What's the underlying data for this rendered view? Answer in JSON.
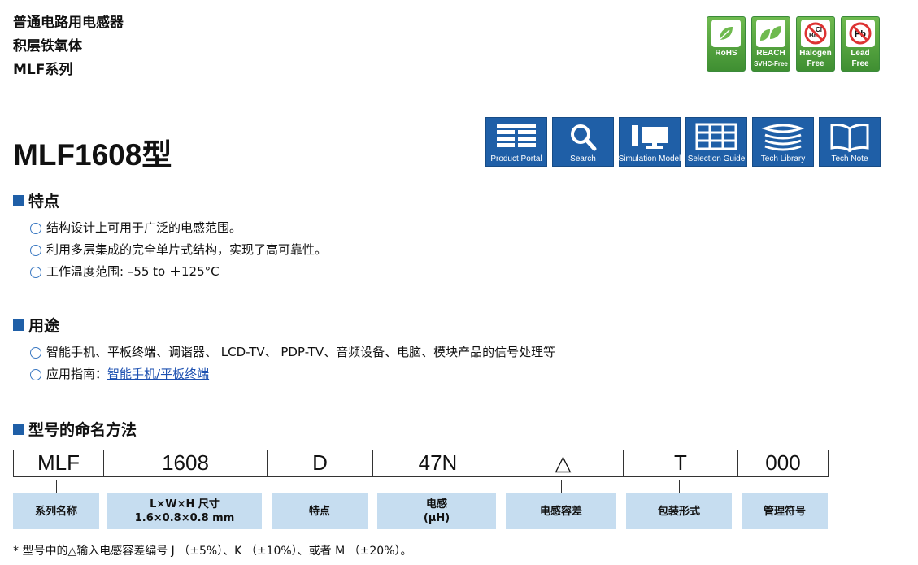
{
  "header": {
    "series_lines": [
      "普通电路用电感器",
      "积层铁氧体",
      "MLF系列"
    ],
    "badges": [
      {
        "icon": "leaf-icon",
        "lines": [
          "RoHS"
        ]
      },
      {
        "icon": "leaf-pair-icon",
        "lines": [
          "REACH",
          "SVHC-Free"
        ]
      },
      {
        "icon": "no-halogen-icon",
        "mark": "ClBr",
        "lines": [
          "Halogen",
          "Free"
        ]
      },
      {
        "icon": "no-lead-icon",
        "mark": "Pb",
        "lines": [
          "Lead",
          "Free"
        ]
      }
    ]
  },
  "model_title": "MLF1608型",
  "tools": [
    {
      "icon": "product-portal-icon",
      "label": "Product Portal"
    },
    {
      "icon": "search-icon",
      "label": "Search"
    },
    {
      "icon": "simulation-model-icon",
      "label": "Simulation Model"
    },
    {
      "icon": "selection-guide-icon",
      "label": "Selection Guide"
    },
    {
      "icon": "tech-library-icon",
      "label": "Tech Library"
    },
    {
      "icon": "tech-note-icon",
      "label": "Tech Note"
    }
  ],
  "features": {
    "heading": "特点",
    "items": [
      "结构设计上可用于广泛的电感范围。",
      "利用多层集成的完全单片式结构，实现了高可靠性。",
      "工作温度范围: –55 to ＋125°C"
    ]
  },
  "applications": {
    "heading": "用途",
    "item1": "智能手机、平板终端、调谐器、 LCD-TV、 PDP-TV、音频设备、电脑、模块产品的信号处理等",
    "guide_prefix": "应用指南：",
    "guide_link": "智能手机/平板终端"
  },
  "naming": {
    "heading": "型号的命名方法",
    "codes": [
      "MLF",
      "1608",
      "D",
      "47N",
      "△",
      "T",
      "000"
    ],
    "labels": [
      [
        "系列名称"
      ],
      [
        "L×W×H 尺寸",
        "1.6×0.8×0.8 mm"
      ],
      [
        "特点"
      ],
      [
        "电感",
        "(μH)"
      ],
      [
        "电感容差"
      ],
      [
        "包装形式"
      ],
      [
        "管理符号"
      ]
    ],
    "note": "* 型号中的△输入电感容差编号 J （±5%）、K （±10%）、或者 M （±20%）。"
  },
  "colors": {
    "accent_blue": "#1f5fa7",
    "label_bg": "#c6ddf0",
    "badge_green": "#4f9f3a",
    "link": "#1b4fb0"
  }
}
